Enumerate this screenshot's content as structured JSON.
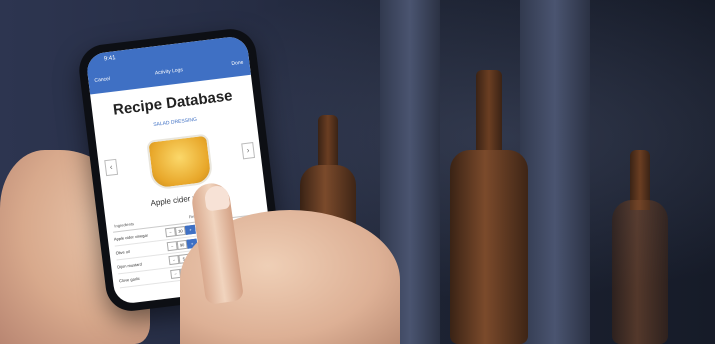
{
  "phone": {
    "status_time": "9:41",
    "nav": {
      "cancel": "Cancel",
      "title": "Activity Logs",
      "done": "Done"
    },
    "title": "Recipe Database",
    "subtitle": "SALAD DRESSING",
    "item_label": "Apple cider vinegar",
    "tabs": [
      "Ingredients",
      "Fine tuning (ml)"
    ],
    "rows": [
      {
        "name": "Apple cider vinegar",
        "value": "30"
      },
      {
        "name": "Olive oil",
        "value": "90"
      },
      {
        "name": "Dijon mustard",
        "value": "5"
      },
      {
        "name": "Clove garlic",
        "value": "1"
      }
    ],
    "nav_prev": "‹",
    "nav_next": "›",
    "minus": "−",
    "plus": "+"
  },
  "colors": {
    "accent": "#3f70c4",
    "bottle": "#7b4a2b",
    "liquid": "#e8a72a"
  }
}
